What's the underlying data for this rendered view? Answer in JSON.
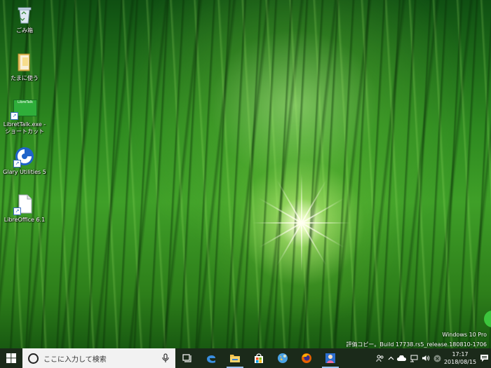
{
  "desktop": {
    "icons": [
      {
        "label": "ごみ箱",
        "icon": "recycle-bin-icon"
      },
      {
        "label": "たまに使う",
        "icon": "folder-icon"
      },
      {
        "label": "LibretTalk.exe - ショートカット",
        "icon": "libretalk-shortcut-icon",
        "badge_text": "LibreTalk"
      },
      {
        "label": "Glary Utilities 5",
        "icon": "glary-utilities-icon"
      },
      {
        "label": "LibreOffice 6.1",
        "icon": "libreoffice-document-icon"
      }
    ]
  },
  "watermark": {
    "edition": "Windows 10 Pro",
    "build": "評価コピー。Build 17738.rs5_release.180810-1706"
  },
  "taskbar": {
    "search_placeholder": "ここに入力して検索",
    "pinned": [
      {
        "name": "task-view",
        "icon": "task-view-icon"
      },
      {
        "name": "edge",
        "icon": "edge-icon"
      },
      {
        "name": "file-explorer",
        "icon": "folder-icon"
      },
      {
        "name": "store",
        "icon": "store-icon"
      },
      {
        "name": "app-globe",
        "icon": "globe-icon"
      },
      {
        "name": "firefox",
        "icon": "firefox-icon"
      },
      {
        "name": "app-character",
        "icon": "character-app-icon"
      }
    ],
    "tray": {
      "time": "17:17",
      "date": "2018/08/15"
    },
    "colors": {
      "bar": "#1b2a1a",
      "search_bg": "#f2f2f2",
      "active_indicator": "#9cc4f0"
    }
  }
}
